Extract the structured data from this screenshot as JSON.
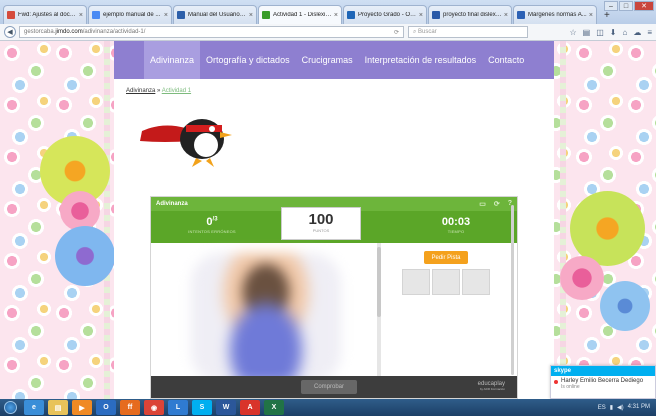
{
  "browser": {
    "tabs": [
      {
        "label": "Fwd: Ajustes al docu...",
        "icon": "gmail-icon",
        "color": "#d54b3d",
        "active": false
      },
      {
        "label": "ejemplo manual de ...",
        "icon": "google-icon",
        "color": "#4a8af4",
        "active": false
      },
      {
        "label": "Manual del Usuario - ...",
        "icon": "docs-icon",
        "color": "#2d5faa",
        "active": false
      },
      {
        "label": "Actividad 1 - Dislexia...",
        "icon": "jimdo-icon",
        "color": "#3a9d2b",
        "active": true
      },
      {
        "label": "Proyecto Grado - On...",
        "icon": "onedrive-icon",
        "color": "#1f66b7",
        "active": false
      },
      {
        "label": "proyecto final dislexi...",
        "icon": "word-icon",
        "color": "#2a5aa8",
        "active": false
      },
      {
        "label": "Márgenes normas A...",
        "icon": "doc-icon",
        "color": "#2c61b5",
        "active": false
      }
    ],
    "new_tab": "+",
    "url_prefix": "gestorcaba.",
    "url_domain": "jimdo.com",
    "url_path": "/adivinanza/actividad-1/",
    "search_placeholder": "Buscar"
  },
  "site": {
    "nav": [
      {
        "label": "Adivinanza",
        "active": true
      },
      {
        "label": "Ortografía y dictados",
        "active": false
      },
      {
        "label": "Crucigramas",
        "active": false
      },
      {
        "label": "Interpretación de resultados",
        "active": false
      },
      {
        "label": "Contacto",
        "active": false
      }
    ],
    "breadcrumb": {
      "parent": "Adivinanza",
      "sep": "»",
      "current": "Actividad 1"
    }
  },
  "game": {
    "title": "Adivinanza",
    "attempts": {
      "value": "0",
      "sup": "/3",
      "label": "INTENTOS ERRÓNEOS"
    },
    "score": {
      "value": "100",
      "label": "PUNTOS"
    },
    "time": {
      "value": "00:03",
      "label": "TIEMPO"
    },
    "hint_button": "Pedir Pista",
    "check_button": "Comprobar",
    "brand": "educaplay",
    "brand_sub": "by ADR Formación"
  },
  "skype": {
    "title": "skype",
    "contact": "Harley Emilio Becerra Dediego",
    "status": "Is online"
  },
  "taskbar": {
    "apps": [
      {
        "icon": "ie-icon",
        "color": "#3a8ed8",
        "glyph": "e"
      },
      {
        "icon": "explorer-icon",
        "color": "#e8c35a",
        "glyph": "▤"
      },
      {
        "icon": "media-player-icon",
        "color": "#f08a24",
        "glyph": "▶"
      },
      {
        "icon": "outlook-icon",
        "color": "#2b6cc1",
        "glyph": "O"
      },
      {
        "icon": "firefox-icon",
        "color": "#e66b1e",
        "glyph": "ff"
      },
      {
        "icon": "chrome-icon",
        "color": "#db4437",
        "glyph": "◉"
      },
      {
        "icon": "lync-icon",
        "color": "#2f7bd1",
        "glyph": "L"
      },
      {
        "icon": "skype-icon",
        "color": "#00aff0",
        "glyph": "S"
      },
      {
        "icon": "word-icon",
        "color": "#2b579a",
        "glyph": "W"
      },
      {
        "icon": "pdf-icon",
        "color": "#d9342b",
        "glyph": "A"
      },
      {
        "icon": "excel-icon",
        "color": "#217346",
        "glyph": "X"
      }
    ],
    "language": "ES",
    "time": "4:31 PM"
  }
}
